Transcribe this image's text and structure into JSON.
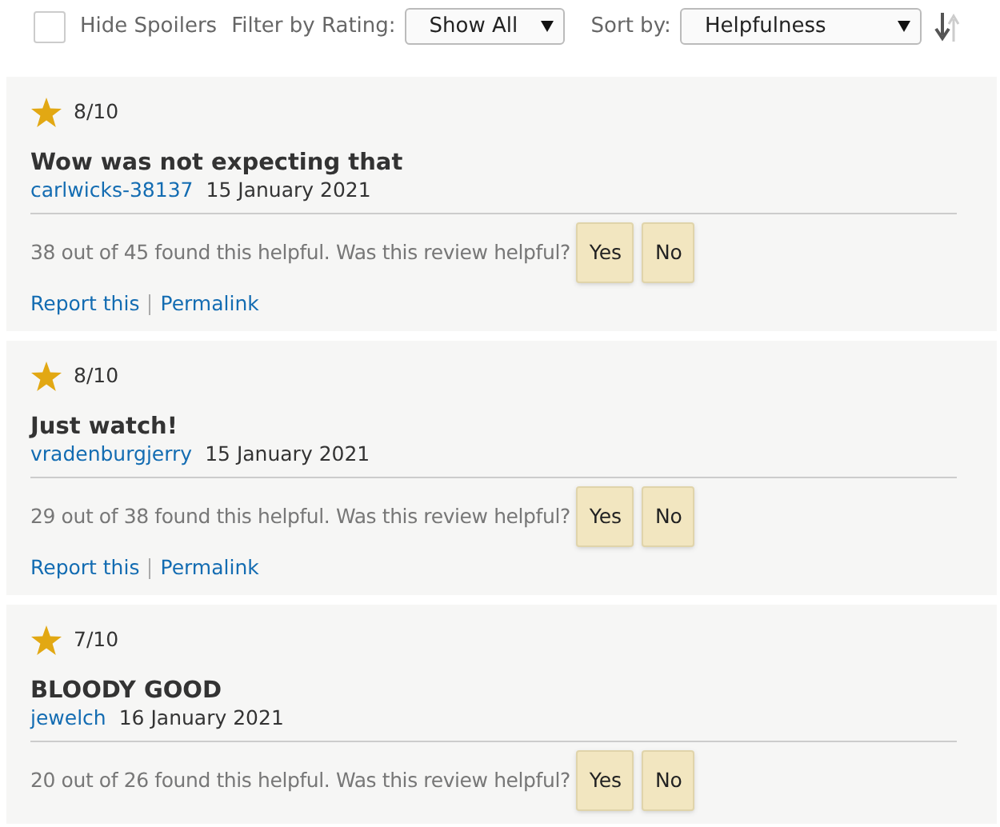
{
  "toolbar": {
    "hide_spoilers": {
      "label": "Hide Spoilers",
      "checked": false
    },
    "filter_label": "Filter by Rating:",
    "filter_value": "Show All",
    "sort_label": "Sort by:",
    "sort_value": "Helpfulness"
  },
  "reviews": [
    {
      "rating": "8/10",
      "title": "Wow was not expecting that",
      "author": "carlwicks-38137",
      "date": "15 January 2021",
      "helpful": "38 out of 45 found this helpful. Was this review helpful?",
      "yes": "Yes",
      "no": "No",
      "links": [
        "Report this",
        "Permalink"
      ]
    },
    {
      "rating": "8/10",
      "title": "Just watch!",
      "author": "vradenburgjerry",
      "date": "15 January 2021",
      "helpful": "29 out of 38 found this helpful. Was this review helpful?",
      "yes": "Yes",
      "no": "No",
      "links": [
        "Report this",
        "Permalink"
      ]
    },
    {
      "rating": "7/10",
      "title": "BLOODY GOOD",
      "author": "jewelch",
      "date": "16 January 2021",
      "helpful": "20 out of 26 found this helpful. Was this review helpful?",
      "yes": "Yes",
      "no": "No"
    }
  ]
}
